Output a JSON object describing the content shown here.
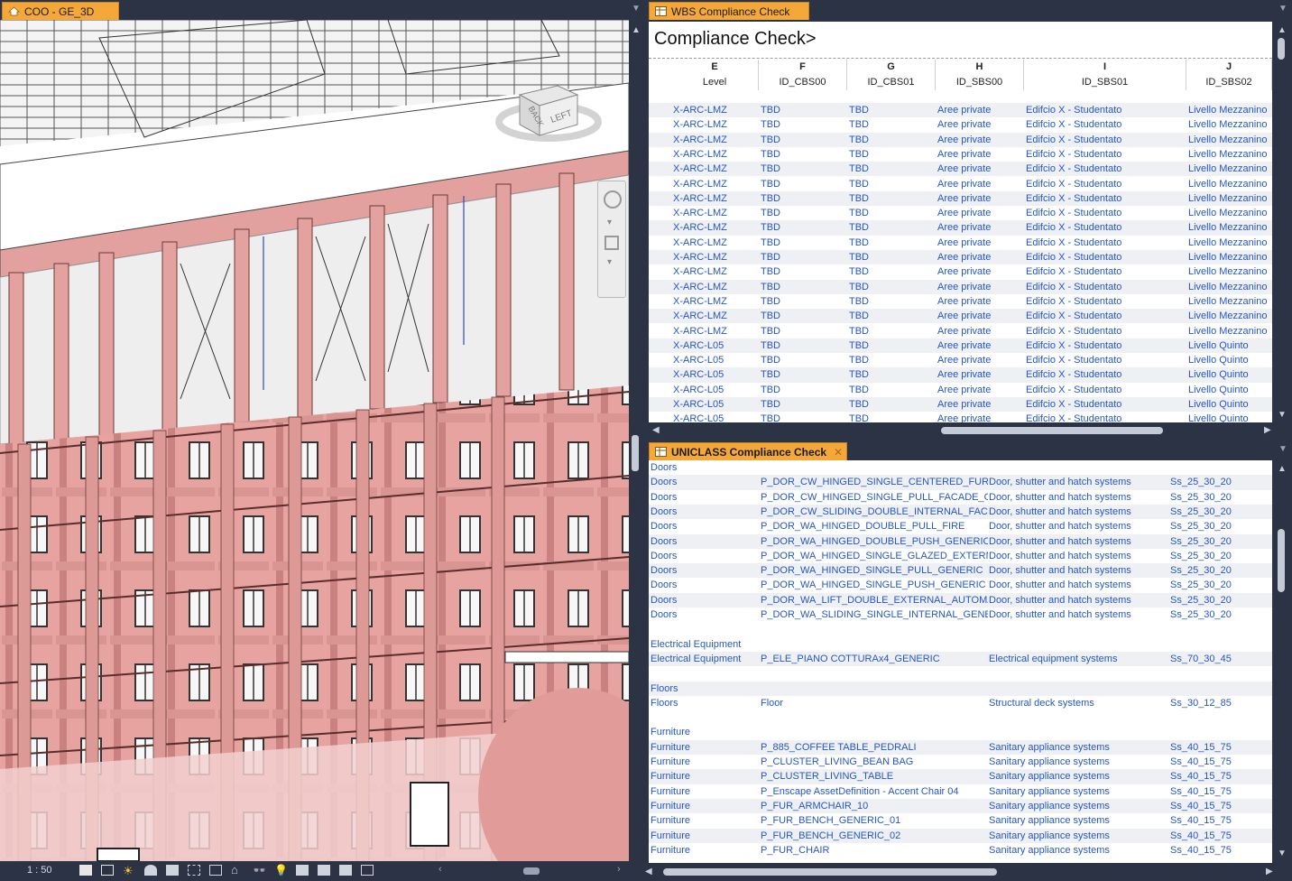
{
  "left_view": {
    "tab_label": "COO - GE_3D",
    "scale": "1 : 50",
    "viewcube": {
      "face_left": "LEFT",
      "face_back": "BACK"
    }
  },
  "wbs": {
    "tab_label": "WBS Compliance Check",
    "title": "Compliance Check>",
    "columns": [
      {
        "letter": "E",
        "field": "Level"
      },
      {
        "letter": "F",
        "field": "ID_CBS00"
      },
      {
        "letter": "G",
        "field": "ID_CBS01"
      },
      {
        "letter": "H",
        "field": "ID_SBS00"
      },
      {
        "letter": "I",
        "field": "ID_SBS01"
      },
      {
        "letter": "J",
        "field": "ID_SBS02"
      }
    ],
    "rows": [
      [
        "X-ARC-LMZ",
        "TBD",
        "TBD",
        "Aree private",
        "Edifcio X - Studentato",
        "Livello Mezzanino"
      ],
      [
        "X-ARC-LMZ",
        "TBD",
        "TBD",
        "Aree private",
        "Edifcio X - Studentato",
        "Livello Mezzanino"
      ],
      [
        "X-ARC-LMZ",
        "TBD",
        "TBD",
        "Aree private",
        "Edifcio X - Studentato",
        "Livello Mezzanino"
      ],
      [
        "X-ARC-LMZ",
        "TBD",
        "TBD",
        "Aree private",
        "Edifcio X - Studentato",
        "Livello Mezzanino"
      ],
      [
        "X-ARC-LMZ",
        "TBD",
        "TBD",
        "Aree private",
        "Edifcio X - Studentato",
        "Livello Mezzanino"
      ],
      [
        "X-ARC-LMZ",
        "TBD",
        "TBD",
        "Aree private",
        "Edifcio X - Studentato",
        "Livello Mezzanino"
      ],
      [
        "X-ARC-LMZ",
        "TBD",
        "TBD",
        "Aree private",
        "Edifcio X - Studentato",
        "Livello Mezzanino"
      ],
      [
        "X-ARC-LMZ",
        "TBD",
        "TBD",
        "Aree private",
        "Edifcio X - Studentato",
        "Livello Mezzanino"
      ],
      [
        "X-ARC-LMZ",
        "TBD",
        "TBD",
        "Aree private",
        "Edifcio X - Studentato",
        "Livello Mezzanino"
      ],
      [
        "X-ARC-LMZ",
        "TBD",
        "TBD",
        "Aree private",
        "Edifcio X - Studentato",
        "Livello Mezzanino"
      ],
      [
        "X-ARC-LMZ",
        "TBD",
        "TBD",
        "Aree private",
        "Edifcio X - Studentato",
        "Livello Mezzanino"
      ],
      [
        "X-ARC-LMZ",
        "TBD",
        "TBD",
        "Aree private",
        "Edifcio X - Studentato",
        "Livello Mezzanino"
      ],
      [
        "X-ARC-LMZ",
        "TBD",
        "TBD",
        "Aree private",
        "Edifcio X - Studentato",
        "Livello Mezzanino"
      ],
      [
        "X-ARC-LMZ",
        "TBD",
        "TBD",
        "Aree private",
        "Edifcio X - Studentato",
        "Livello Mezzanino"
      ],
      [
        "X-ARC-LMZ",
        "TBD",
        "TBD",
        "Aree private",
        "Edifcio X - Studentato",
        "Livello Mezzanino"
      ],
      [
        "X-ARC-LMZ",
        "TBD",
        "TBD",
        "Aree private",
        "Edifcio X - Studentato",
        "Livello Mezzanino"
      ],
      [
        "X-ARC-L05",
        "TBD",
        "TBD",
        "Aree private",
        "Edifcio X - Studentato",
        "Livello Quinto"
      ],
      [
        "X-ARC-L05",
        "TBD",
        "TBD",
        "Aree private",
        "Edifcio X - Studentato",
        "Livello Quinto"
      ],
      [
        "X-ARC-L05",
        "TBD",
        "TBD",
        "Aree private",
        "Edifcio X - Studentato",
        "Livello Quinto"
      ],
      [
        "X-ARC-L05",
        "TBD",
        "TBD",
        "Aree private",
        "Edifcio X - Studentato",
        "Livello Quinto"
      ],
      [
        "X-ARC-L05",
        "TBD",
        "TBD",
        "Aree private",
        "Edifcio X - Studentato",
        "Livello Quinto"
      ],
      [
        "X-ARC-L05",
        "TBD",
        "TBD",
        "Aree private",
        "Edifcio X - Studentato",
        "Livello Quinto"
      ]
    ]
  },
  "uniclass": {
    "tab_label": "UNICLASS Compliance Check",
    "rows": [
      [
        "Doors",
        "",
        "",
        ""
      ],
      [
        "Doors",
        "P_DOR_CW_HINGED_SINGLE_CENTERED_FURNIT",
        "Door, shutter and hatch systems",
        "Ss_25_30_20"
      ],
      [
        "Doors",
        "P_DOR_CW_HINGED_SINGLE_PULL_FACADE_GL",
        "Door, shutter and hatch systems",
        "Ss_25_30_20"
      ],
      [
        "Doors",
        "P_DOR_CW_SLIDING_DOUBLE_INTERNAL_FACAD",
        "Door, shutter and hatch systems",
        "Ss_25_30_20"
      ],
      [
        "Doors",
        "P_DOR_WA_HINGED_DOUBLE_PULL_FIRE",
        "Door, shutter and hatch systems",
        "Ss_25_30_20"
      ],
      [
        "Doors",
        "P_DOR_WA_HINGED_DOUBLE_PUSH_GENERIC",
        "Door, shutter and hatch systems",
        "Ss_25_30_20"
      ],
      [
        "Doors",
        "P_DOR_WA_HINGED_SINGLE_GLAZED_EXTERNA",
        "Door, shutter and hatch systems",
        "Ss_25_30_20"
      ],
      [
        "Doors",
        "P_DOR_WA_HINGED_SINGLE_PULL_GENERIC",
        "Door, shutter and hatch systems",
        "Ss_25_30_20"
      ],
      [
        "Doors",
        "P_DOR_WA_HINGED_SINGLE_PUSH_GENERIC",
        "Door, shutter and hatch systems",
        "Ss_25_30_20"
      ],
      [
        "Doors",
        "P_DOR_WA_LIFT_DOUBLE_EXTERNAL_AUTOMA",
        "Door, shutter and hatch systems",
        "Ss_25_30_20"
      ],
      [
        "Doors",
        "P_DOR_WA_SLIDING_SINGLE_INTERNAL_GENERI",
        "Door, shutter and hatch systems",
        "Ss_25_30_20"
      ],
      [
        "",
        "",
        "",
        ""
      ],
      [
        "Electrical Equipment",
        "",
        "",
        ""
      ],
      [
        "Electrical Equipment",
        "P_ELE_PIANO COTTURAx4_GENERIC",
        "Electrical equipment systems",
        "Ss_70_30_45"
      ],
      [
        "",
        "",
        "",
        ""
      ],
      [
        "Floors",
        "",
        "",
        ""
      ],
      [
        "Floors",
        "Floor",
        "Structural deck systems",
        "Ss_30_12_85"
      ],
      [
        "",
        "",
        "",
        ""
      ],
      [
        "Furniture",
        "",
        "",
        ""
      ],
      [
        "Furniture",
        "P_885_COFFEE TABLE_PEDRALI",
        "Sanitary appliance systems",
        "Ss_40_15_75"
      ],
      [
        "Furniture",
        "P_CLUSTER_LIVING_BEAN BAG",
        "Sanitary appliance systems",
        "Ss_40_15_75"
      ],
      [
        "Furniture",
        "P_CLUSTER_LIVING_TABLE",
        "Sanitary appliance systems",
        "Ss_40_15_75"
      ],
      [
        "Furniture",
        "P_Enscape AssetDefinition - Accent Chair 04",
        "Sanitary appliance systems",
        "Ss_40_15_75"
      ],
      [
        "Furniture",
        "P_FUR_ARMCHAIR_10",
        "Sanitary appliance systems",
        "Ss_40_15_75"
      ],
      [
        "Furniture",
        "P_FUR_BENCH_GENERIC_01",
        "Sanitary appliance systems",
        "Ss_40_15_75"
      ],
      [
        "Furniture",
        "P_FUR_BENCH_GENERIC_02",
        "Sanitary appliance systems",
        "Ss_40_15_75"
      ],
      [
        "Furniture",
        "P_FUR_CHAIR",
        "Sanitary appliance systems",
        "Ss_40_15_75"
      ]
    ]
  },
  "colors": {
    "accent_tab": "#f4a83a",
    "link_text": "#2456c8",
    "chrome": "#2b3345",
    "facade": "#e8a8a4"
  }
}
